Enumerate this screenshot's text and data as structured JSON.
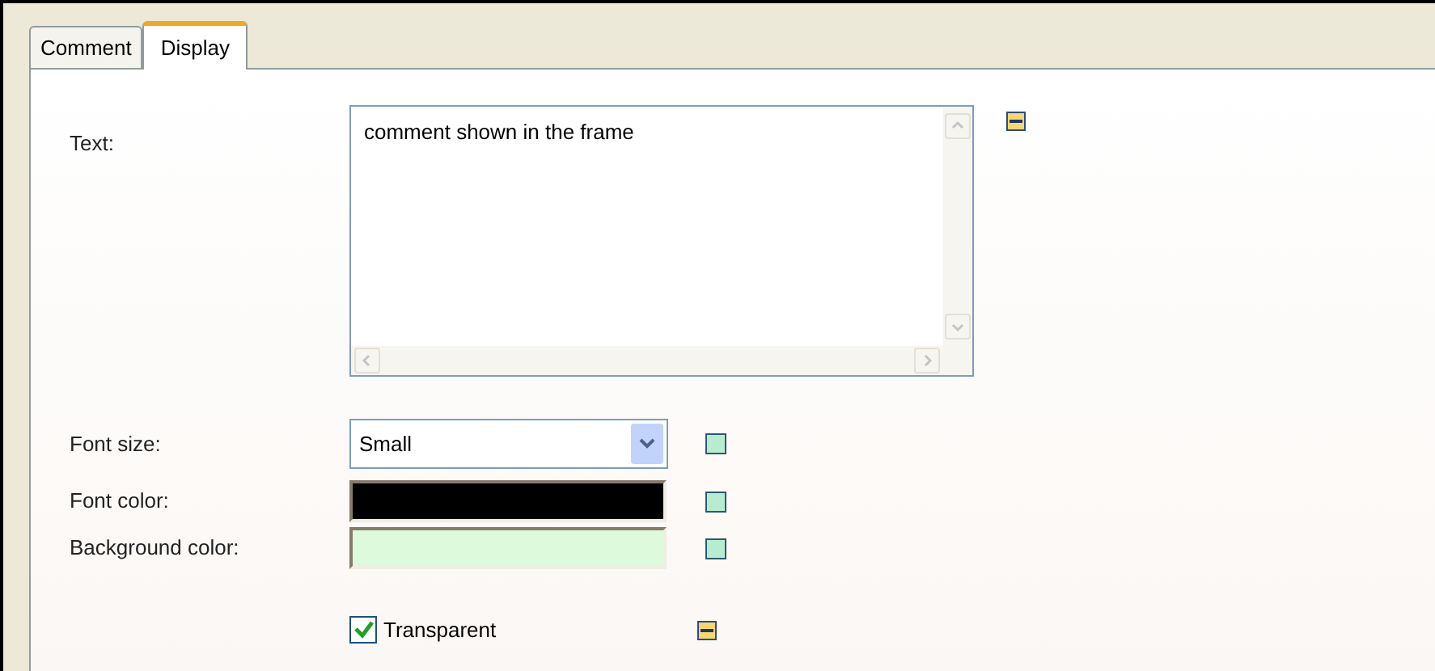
{
  "tabs": [
    {
      "label": "Comment",
      "selected": false
    },
    {
      "label": "Display",
      "selected": true
    }
  ],
  "text_field": {
    "label": "Text:",
    "value": "comment shown in the frame"
  },
  "font_size": {
    "label": "Font size:",
    "value": "Small"
  },
  "font_color": {
    "label": "Font color:",
    "color": "#000000"
  },
  "background_color": {
    "label": "Background color:",
    "color": "#ddfadd"
  },
  "transparent": {
    "label": "Transparent",
    "checked": true
  }
}
